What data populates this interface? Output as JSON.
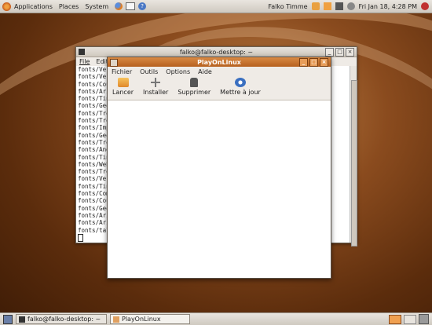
{
  "top_panel": {
    "menus": [
      "Applications",
      "Places",
      "System"
    ],
    "user": "Falko Timme",
    "clock": "Fri Jan 18,  4:28 PM"
  },
  "terminal": {
    "title": "falko@falko-desktop: ~",
    "menu": [
      "File",
      "Edit"
    ],
    "lines": [
      "fonts/Ver",
      "fonts/Ver",
      "fonts/Cou",
      "fonts/Ari",
      "fonts/Tin",
      "fonts/Geo",
      "fonts/Tre",
      "fonts/Tre",
      "fonts/Imp",
      "fonts/Geo",
      "fonts/Tre",
      "fonts/And",
      "fonts/Tin",
      "fonts/Web",
      "fonts/Tre",
      "fonts/Ver",
      "fonts/Tin",
      "fonts/Com",
      "fonts/Cou",
      "fonts/Geo",
      "fonts/Ari",
      "fonts/Ari",
      "fonts/tal"
    ]
  },
  "playonlinux": {
    "title": "PlayOnLinux",
    "menu": [
      "Fichier",
      "Outils",
      "Options",
      "Aide"
    ],
    "toolbar": [
      "Lancer",
      "Installer",
      "Supprimer",
      "Mettre à jour"
    ]
  },
  "taskbar": {
    "tasks": [
      "falko@falko-desktop: ~",
      "PlayOnLinux"
    ]
  }
}
